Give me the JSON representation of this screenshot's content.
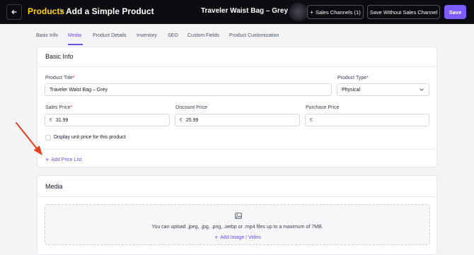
{
  "header": {
    "back_icon": "arrow-left-icon",
    "breadcrumb_root": "Products",
    "breadcrumb_page": "Add a Simple Product",
    "product_name": "Traveler Waist Bag – Grey",
    "sales_channels_label": "Sales Channels (1)",
    "save_without_label": "Save Without Sales Channel",
    "save_label": "Save",
    "colors": {
      "bar": "#0c0c10",
      "breadcrumb_root": "#ffd400",
      "accent": "#7c5cff"
    }
  },
  "tabs": [
    {
      "label": "Basic Info",
      "active": false
    },
    {
      "label": "Media",
      "active": true
    },
    {
      "label": "Product Details",
      "active": false
    },
    {
      "label": "Inventory",
      "active": false
    },
    {
      "label": "SEO",
      "active": false
    },
    {
      "label": "Custom Fields",
      "active": false
    },
    {
      "label": "Product Customization",
      "active": false
    }
  ],
  "basic_info": {
    "title": "Basic Info",
    "product_title_label": "Product Title",
    "product_title_value": "Traveler Waist Bag – Grey",
    "product_type_label": "Product Type",
    "product_type_value": "Physical",
    "sales_price_label": "Sales Price",
    "sales_price_value": "31.99",
    "discount_price_label": "Discount Price",
    "discount_price_value": "25.99",
    "purchase_price_label": "Purchase Price",
    "purchase_price_value": "",
    "currency_symbol": "€",
    "required_mark": "*",
    "unit_price_checkbox_label": "Display unit price for this product",
    "unit_price_checked": false,
    "add_price_list_label": "Add Price List"
  },
  "media": {
    "title": "Media",
    "upload_hint": "You can upload .jpeg, .jpg, .png, .webp or .mp4 files up to a maximum of 7MB.",
    "add_media_label": "Add Image / Video"
  },
  "annotation": {
    "color": "#e53e1f",
    "points_to": "Add Price List"
  }
}
